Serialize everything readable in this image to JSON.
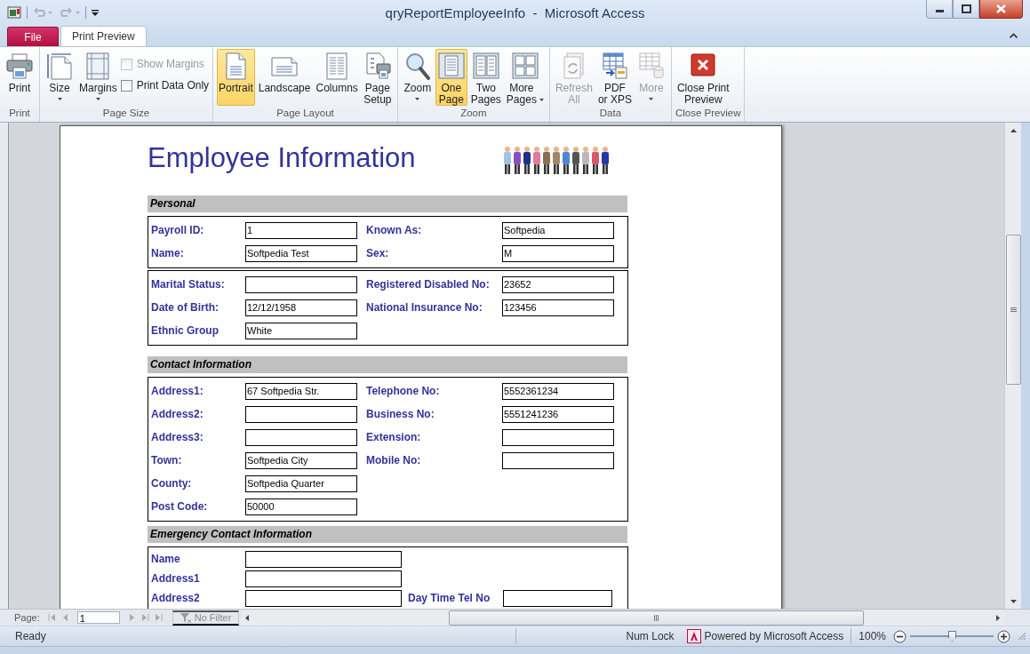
{
  "window": {
    "title": "qryReportEmployeeInfo  -  Microsoft Access"
  },
  "tabs": [
    {
      "label": "File",
      "kind": "file",
      "selected": false
    },
    {
      "label": "Print Preview",
      "kind": "tab",
      "selected": true
    }
  ],
  "ribbon": {
    "groups": [
      {
        "label": "Print",
        "items": [
          {
            "label": "Print",
            "kind": "large",
            "selected": false,
            "disabled": false,
            "dropdown": false
          }
        ]
      },
      {
        "label": "Page Size",
        "items": [
          {
            "label": "Size",
            "kind": "large",
            "selected": false,
            "disabled": false,
            "dropdown": true
          },
          {
            "label": "Margins",
            "kind": "large",
            "selected": false,
            "disabled": false,
            "dropdown": true
          },
          {
            "label": "Show Margins",
            "kind": "check",
            "checked": false,
            "disabled": true
          },
          {
            "label": "Print Data Only",
            "kind": "check",
            "checked": false,
            "disabled": false
          }
        ]
      },
      {
        "label": "Page Layout",
        "items": [
          {
            "label": "Portrait",
            "kind": "large",
            "selected": true,
            "disabled": false,
            "dropdown": false
          },
          {
            "label": "Landscape",
            "kind": "large",
            "selected": false,
            "disabled": false,
            "dropdown": false
          },
          {
            "label": "Columns",
            "kind": "large",
            "selected": false,
            "disabled": false,
            "dropdown": false
          },
          {
            "label": "Page\nSetup",
            "kind": "large",
            "selected": false,
            "disabled": false,
            "dropdown": false
          }
        ]
      },
      {
        "label": "Zoom",
        "items": [
          {
            "label": "Zoom",
            "kind": "large",
            "selected": false,
            "disabled": false,
            "dropdown": true
          },
          {
            "label": "One\nPage",
            "kind": "large",
            "selected": true,
            "disabled": false,
            "dropdown": false
          },
          {
            "label": "Two\nPages",
            "kind": "large",
            "selected": false,
            "disabled": false,
            "dropdown": false
          },
          {
            "label": "More\nPages",
            "kind": "large",
            "selected": false,
            "disabled": false,
            "dropdown": true
          }
        ]
      },
      {
        "label": "Data",
        "items": [
          {
            "label": "Refresh\nAll",
            "kind": "large",
            "selected": false,
            "disabled": true,
            "dropdown": false
          },
          {
            "label": "PDF\nor XPS",
            "kind": "large",
            "selected": false,
            "disabled": false,
            "dropdown": false
          },
          {
            "label": "More",
            "kind": "large",
            "selected": false,
            "disabled": true,
            "dropdown": true
          }
        ]
      },
      {
        "label": "Close Preview",
        "items": [
          {
            "label": "Close Print\nPreview",
            "kind": "large",
            "selected": false,
            "disabled": false,
            "dropdown": false
          }
        ]
      }
    ]
  },
  "report": {
    "title": "Employee Information",
    "sections": [
      {
        "heading": "Personal",
        "kind": "standard",
        "blocks": [
          {
            "rows": [
              [
                {
                  "label": "Payroll ID:",
                  "value": "1"
                },
                {
                  "label": "Known As:",
                  "value": "Softpedia"
                }
              ],
              [
                {
                  "label": "Name:",
                  "value": "Softpedia Test"
                },
                {
                  "label": "Sex:",
                  "value": "M"
                }
              ]
            ]
          },
          {
            "rows": [
              [
                {
                  "label": "Marital Status:"
                },
                {
                  "label": "Registered Disabled No:",
                  "value": "23652"
                }
              ],
              [
                {
                  "label": "Date of Birth:",
                  "value": "12/12/1958"
                },
                {
                  "label": "National Insurance No:",
                  "value": "123456"
                }
              ],
              [
                {
                  "label": "Ethnic Group",
                  "value": "White"
                }
              ]
            ]
          }
        ]
      },
      {
        "heading": "Contact Information",
        "kind": "standard",
        "blocks": [
          {
            "rows": [
              [
                {
                  "label": "Address1:",
                  "value": "67 Softpedia Str."
                },
                {
                  "label": "Telephone No:",
                  "value": "5552361234"
                }
              ],
              [
                {
                  "label": "Address2:"
                },
                {
                  "label": "Business No:",
                  "value": "5551241236"
                }
              ],
              [
                {
                  "label": "Address3:"
                },
                {
                  "label": "Extension:"
                }
              ],
              [
                {
                  "label": "Town:",
                  "value": "Softpedia City"
                },
                {
                  "label": "Mobile No:"
                }
              ],
              [
                {
                  "label": "County:",
                  "value": "Softpedia Quarter"
                }
              ],
              [
                {
                  "label": "Post Code:",
                  "value": "50000"
                }
              ]
            ]
          }
        ]
      },
      {
        "heading": "Emergency Contact Information",
        "kind": "wide",
        "blocks": [
          {
            "rows": [
              [
                {
                  "label": "Name"
                }
              ],
              [
                {
                  "label": "Address1"
                }
              ],
              [
                {
                  "label": "Address2"
                },
                {
                  "label": "Day Time Tel No"
                }
              ]
            ]
          }
        ]
      }
    ]
  },
  "navigation": {
    "page_label": "Page:",
    "page": "1",
    "filter": "No Filter"
  },
  "status_bar": {
    "status": "Ready",
    "num_lock": "Num Lock",
    "powered_by": "Powered by Microsoft Access",
    "zoom": "100%",
    "zoom_slider": {
      "level": 0.5
    }
  }
}
